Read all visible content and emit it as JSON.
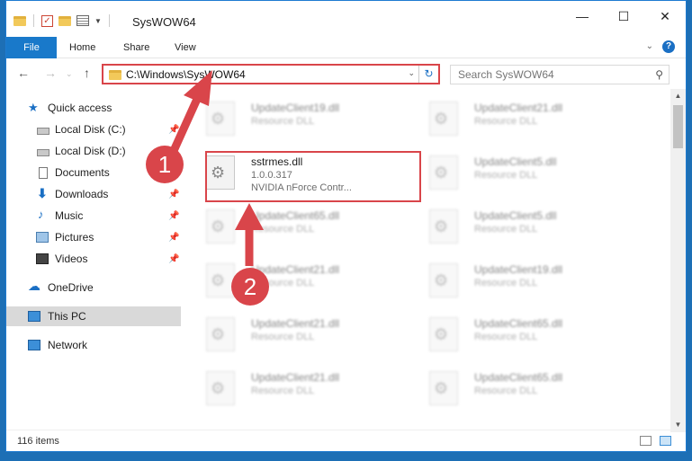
{
  "window": {
    "title": "SysWOW64",
    "minimize_glyph": "—",
    "maximize_glyph": "☐",
    "close_glyph": "✕"
  },
  "ribbon": {
    "tabs": [
      "File",
      "Home",
      "Share",
      "View"
    ],
    "help": "?"
  },
  "nav": {
    "address": "C:\\Windows\\SysWOW64",
    "search_placeholder": "Search SysWOW64"
  },
  "sidebar": {
    "items": [
      {
        "label": "Quick access",
        "icon": "star-icon"
      },
      {
        "label": "Local Disk (C:)",
        "icon": "drive-icon",
        "pinned": true
      },
      {
        "label": "Local Disk (D:)",
        "icon": "drive-icon",
        "pinned": true
      },
      {
        "label": "Documents",
        "icon": "documents-icon",
        "pinned": true
      },
      {
        "label": "Downloads",
        "icon": "download-icon",
        "pinned": true
      },
      {
        "label": "Music",
        "icon": "music-icon",
        "pinned": true
      },
      {
        "label": "Pictures",
        "icon": "pictures-icon",
        "pinned": true
      },
      {
        "label": "Videos",
        "icon": "videos-icon",
        "pinned": true
      },
      {
        "label": "OneDrive",
        "icon": "onedrive-icon"
      },
      {
        "label": "This PC",
        "icon": "this-pc-icon",
        "selected": true
      },
      {
        "label": "Network",
        "icon": "network-icon"
      }
    ]
  },
  "files": [
    {
      "name": "UpdateClient19.dll",
      "type": "Resource DLL",
      "blurred": true
    },
    {
      "name": "UpdateClient21.dll",
      "type": "Resource DLL",
      "blurred": true
    },
    {
      "name": "sstrmes.dll",
      "version": "1.0.0.317",
      "description": "NVIDIA nForce Contr...",
      "blurred": false
    },
    {
      "name": "UpdateClient5.dll",
      "type": "Resource DLL",
      "blurred": true
    },
    {
      "name": "UpdateClient65.dll",
      "type": "Resource DLL",
      "blurred": true
    },
    {
      "name": "UpdateClient5.dll",
      "type": "Resource DLL",
      "blurred": true
    },
    {
      "name": "UpdateClient21.dll",
      "type": "Resource DLL",
      "blurred": true
    },
    {
      "name": "UpdateClient19.dll",
      "type": "Resource DLL",
      "blurred": true
    },
    {
      "name": "UpdateClient21.dll",
      "type": "Resource DLL",
      "blurred": true
    },
    {
      "name": "UpdateClient65.dll",
      "type": "Resource DLL",
      "blurred": true
    },
    {
      "name": "UpdateClient21.dll",
      "type": "Resource DLL",
      "blurred": true
    },
    {
      "name": "UpdateClient65.dll",
      "type": "Resource DLL",
      "blurred": true
    }
  ],
  "status": {
    "item_count": "116 items"
  },
  "annotations": {
    "badge1": "1",
    "badge2": "2",
    "color": "#d9454a"
  }
}
